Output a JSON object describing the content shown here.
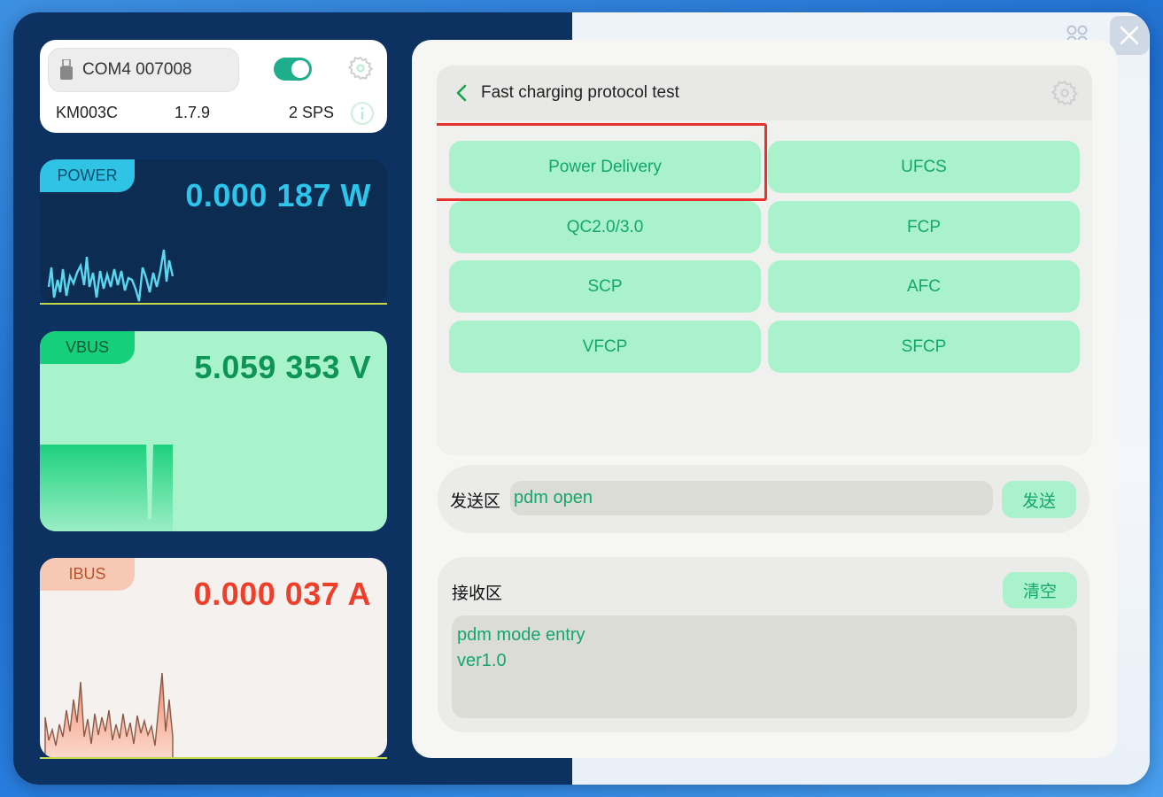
{
  "device": {
    "port": "COM4 007008",
    "model": "KM003C",
    "version": "1.7.9",
    "sps": "2 SPS",
    "connected": true
  },
  "metrics": {
    "power": {
      "label": "POWER",
      "value": "0.000 187 W",
      "color": "#2cc6ec"
    },
    "vbus": {
      "label": "VBUS",
      "value": "5.059 353 V",
      "color": "#0d9556"
    },
    "ibus": {
      "label": "IBUS",
      "value": "0.000 037 A",
      "color": "#ee3f2a"
    }
  },
  "protocol": {
    "title": "Fast charging protocol test",
    "buttons": [
      "Power Delivery",
      "UFCS",
      "QC2.0/3.0",
      "FCP",
      "SCP",
      "AFC",
      "VFCP",
      "SFCP"
    ],
    "highlighted": "Power Delivery"
  },
  "send": {
    "label": "发送区",
    "input_value": "pdm open",
    "button": "发送"
  },
  "receive": {
    "label": "接收区",
    "clear_button": "清空",
    "lines": [
      "pdm mode entry",
      "ver1.0"
    ]
  },
  "icons": [
    "usb-icon",
    "gear-icon",
    "info-icon",
    "grid-icon",
    "close-icon",
    "back-arrow-icon"
  ],
  "colors": {
    "accent": "#14a76a",
    "button_bg": "#a9f2cc",
    "panel_dark": "#0d3160"
  }
}
